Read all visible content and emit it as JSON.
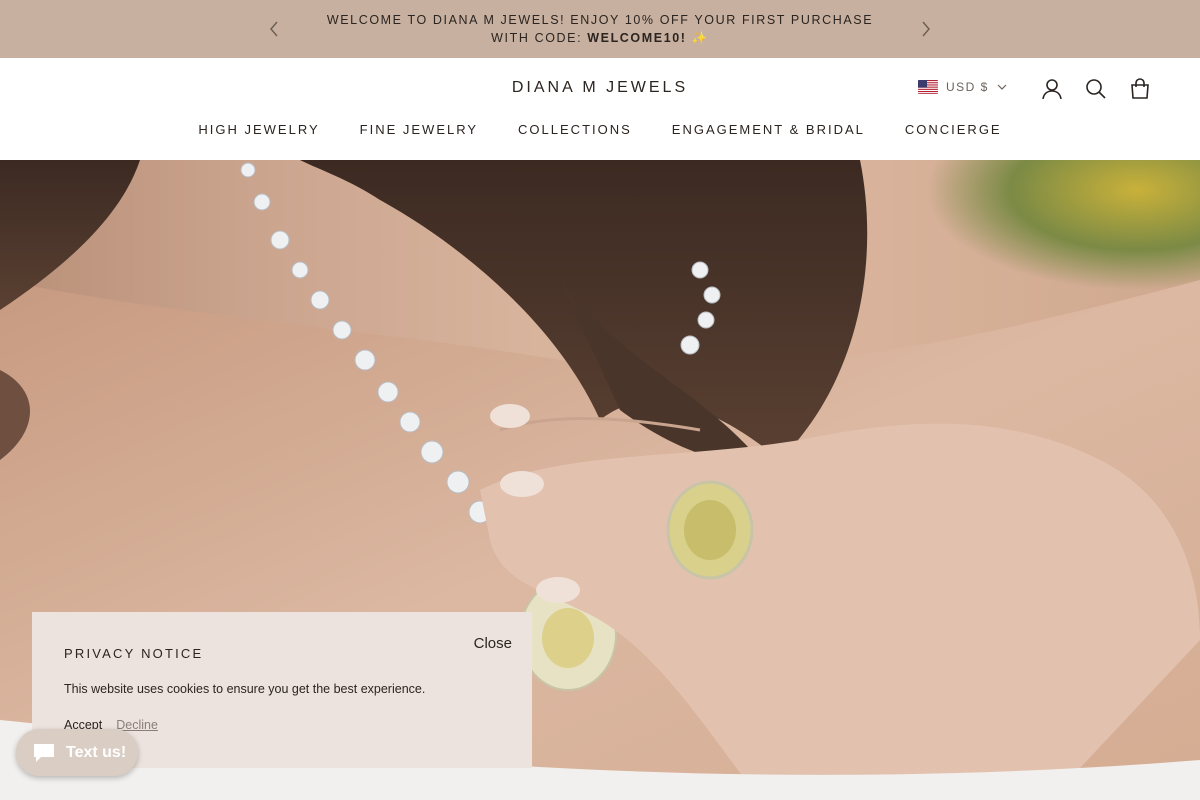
{
  "announcement": {
    "text_lead": "Welcome to Diana M Jewels! Enjoy 10% off your first purchase with code:",
    "code": "WELCOME10!",
    "emoji": "✨"
  },
  "header": {
    "logo": "DIANA M JEWELS",
    "currency": "USD $",
    "icons": [
      "account-icon",
      "search-icon",
      "cart-icon"
    ]
  },
  "nav": {
    "items": [
      "High Jewelry",
      "Fine Jewelry",
      "Collections",
      "Engagement & Bridal",
      "Concierge"
    ]
  },
  "privacy": {
    "title": "PRIVACY NOTICE",
    "close_label": "Close",
    "text": "This website uses cookies to ensure you get the best experience.",
    "accept_label": "Accept",
    "decline_label": "Decline"
  },
  "chat": {
    "label": "Text us!"
  },
  "colors": {
    "announcement_bg": "#c7b09f",
    "popup_bg": "#ede3de",
    "text": "#2b2420"
  }
}
